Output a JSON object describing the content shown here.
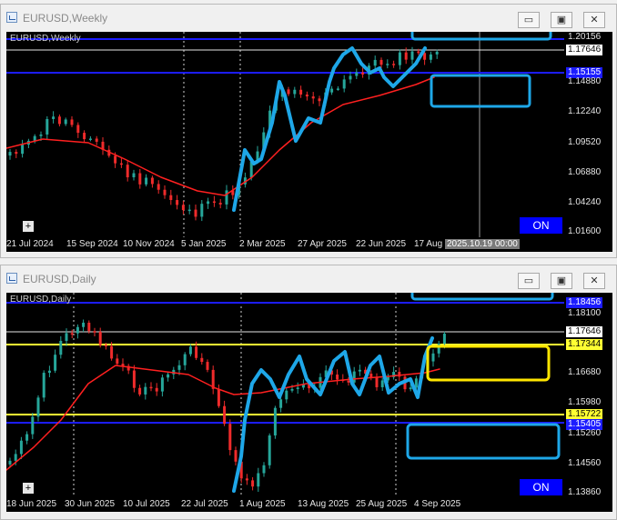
{
  "weekly": {
    "title": "EURUSD,Weekly",
    "chart_label": "EURUSD,Weekly",
    "price_axis": [
      "1.20156",
      "1.17646",
      "1.15155",
      "1.14880",
      "1.12240",
      "1.09520",
      "1.06880",
      "1.04240",
      "1.01600"
    ],
    "price_tags": {
      "top": "1.20156",
      "current": "1.17646",
      "blue": "1.15155"
    },
    "time_axis": [
      "21 Jul 2024",
      "15 Sep 2024",
      "10 Nov 2024",
      "5 Jan 2025",
      "2 Mar 2025",
      "27 Apr 2025",
      "22 Jun 2025",
      "17 Aug",
      "2025.10.19 00:00"
    ],
    "on_label": "ON",
    "plus_label": "+"
  },
  "daily": {
    "title": "EURUSD,Daily",
    "chart_label": "EURUSD,Daily",
    "price_axis": [
      "1.18456",
      "1.18100",
      "1.17646",
      "1.17344",
      "1.16680",
      "1.15980",
      "1.15722",
      "1.15405",
      "1.15260",
      "1.14560",
      "1.13860"
    ],
    "price_tags": {
      "top": "1.18456",
      "current": "1.17646",
      "yellow_top": "1.17344",
      "yellow_bottom": "1.15722",
      "blue": "1.15405"
    },
    "time_axis": [
      "18 Jun 2025",
      "30 Jun 2025",
      "10 Jul 2025",
      "22 Jul 2025",
      "1 Aug 2025",
      "13 Aug 2025",
      "25 Aug 2025",
      "4 Sep 2025"
    ],
    "on_label": "ON",
    "plus_label": "+"
  },
  "window_buttons": {
    "minimize": "▭",
    "restore": "▣",
    "close": "✕"
  },
  "colors": {
    "bull": "#26a69a",
    "bear": "#ef2b2b",
    "ma": "#ff2020",
    "blue_line": "#1c1cff",
    "yellow_line": "#ffff33",
    "annotation": "#1ea7e8",
    "yellow_box": "#ffe600"
  }
}
